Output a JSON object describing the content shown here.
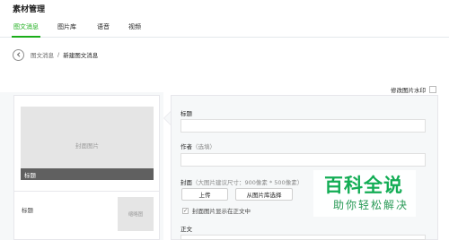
{
  "header": {
    "title": "素材管理"
  },
  "tabs": [
    {
      "label": "图文消息"
    },
    {
      "label": "图片库"
    },
    {
      "label": "语音"
    },
    {
      "label": "视频"
    }
  ],
  "breadcrumb": {
    "parent": "图文消息",
    "separator": "/",
    "current": "新建图文消息"
  },
  "preview": {
    "cover_placeholder": "封面图片",
    "cover_title": "标题",
    "sub_title": "标题",
    "thumb_placeholder": "缩略图"
  },
  "watermark": {
    "label": "修改图片水印"
  },
  "editor": {
    "title_label": "标题",
    "author_label": "作者",
    "author_hint": "（选填）",
    "cover_label": "封面",
    "cover_hint": "（大图片建议尺寸：900像素 * 500像素）",
    "upload_button": "上传",
    "library_button": "从图片库选择",
    "show_cover_checkbox": "封面图片显示在正文中",
    "show_cover_checked": true,
    "body_label": "正文"
  },
  "brand_watermark": {
    "main": "百科全说",
    "sub": "助你轻松解决"
  },
  "colors": {
    "accent": "#1aad19",
    "brand": "#13ad55"
  }
}
